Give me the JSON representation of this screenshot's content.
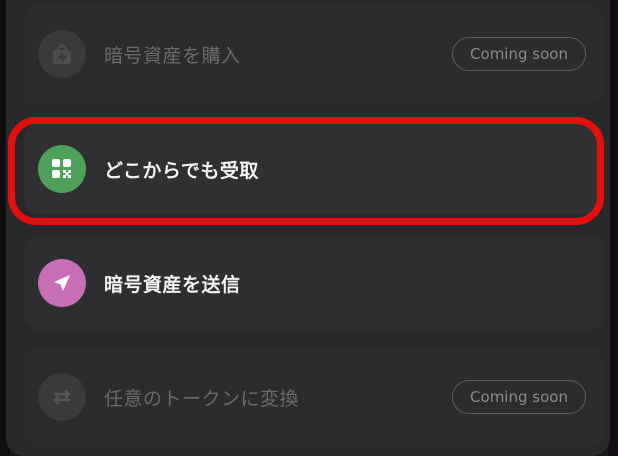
{
  "menu": {
    "items": [
      {
        "label": "暗号資産を購入",
        "icon": "wallet-plus-icon",
        "enabled": false,
        "badge": "Coming soon"
      },
      {
        "label": "どこからでも受取",
        "icon": "qr-code-icon",
        "enabled": true,
        "icon_color": "#4ea05a"
      },
      {
        "label": "暗号資産を送信",
        "icon": "send-arrow-icon",
        "enabled": true,
        "icon_color": "#c76fb6"
      },
      {
        "label": "任意のトークンに変換",
        "icon": "swap-icon",
        "enabled": false,
        "badge": "Coming soon"
      }
    ]
  },
  "colors": {
    "highlight": "#e4100f",
    "panel": "#29292b"
  }
}
